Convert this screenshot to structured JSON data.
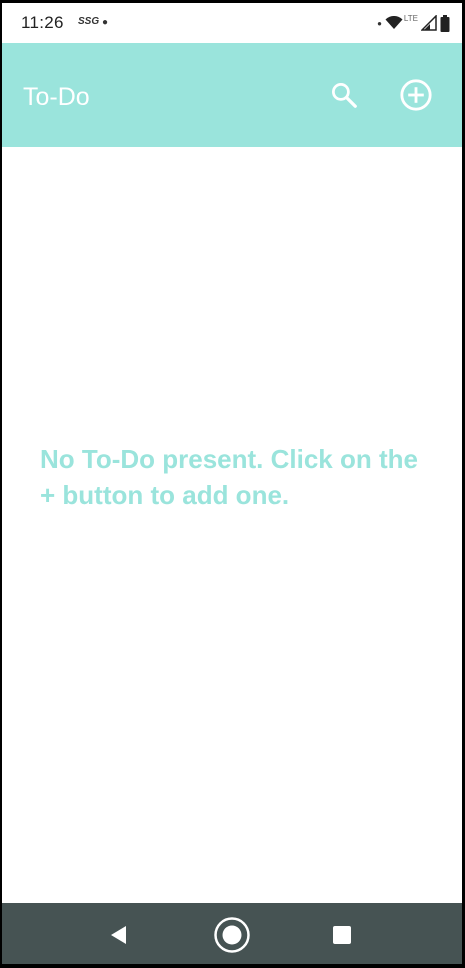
{
  "status_bar": {
    "time": "11:26",
    "carrier": "SSG",
    "network": "LTE"
  },
  "app_bar": {
    "title": "To-Do",
    "search_icon": "search-icon",
    "add_icon": "add-circle-icon"
  },
  "content": {
    "empty_message": "No To-Do present. Click on the + button to add one."
  },
  "nav_bar": {
    "back_icon": "back-triangle-icon",
    "home_icon": "home-circle-icon",
    "recents_icon": "recents-square-icon"
  },
  "colors": {
    "accent": "#9ae4dc",
    "nav_background": "#465353",
    "background": "#ffffff"
  }
}
